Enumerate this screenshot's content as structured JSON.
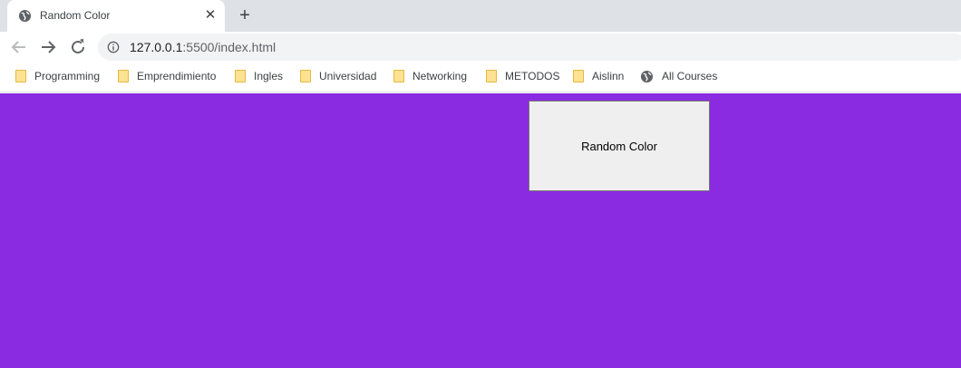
{
  "browser": {
    "tab": {
      "title": "Random Color",
      "close_glyph": "✕"
    },
    "new_tab_glyph": "+",
    "address": {
      "host": "127.0.0.1",
      "path": ":5500/index.html"
    },
    "bookmarks": [
      {
        "label": "Programming",
        "icon": "folder-icon"
      },
      {
        "label": "Emprendimiento",
        "icon": "folder-icon"
      },
      {
        "label": "Ingles",
        "icon": "folder-icon"
      },
      {
        "label": "Universidad",
        "icon": "folder-icon"
      },
      {
        "label": "Networking",
        "icon": "folder-icon"
      },
      {
        "label": "METODOS",
        "icon": "folder-icon"
      },
      {
        "label": "Aislinn",
        "icon": "folder-icon"
      },
      {
        "label": "All Courses",
        "icon": "globe-icon"
      }
    ]
  },
  "page": {
    "background_color": "#8a2be2",
    "button_label": "Random Color"
  }
}
